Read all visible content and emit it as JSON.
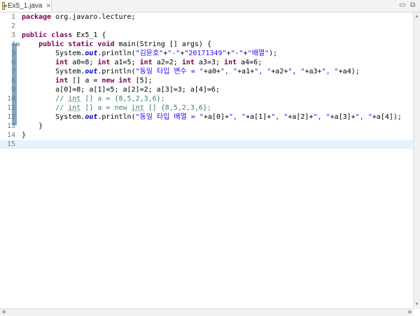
{
  "tab": {
    "label": "Ex5_1.java",
    "close": "✕"
  },
  "window": {
    "minimize": "▭",
    "maximize": "⧉"
  },
  "lines": [
    {
      "n": "1"
    },
    {
      "n": "2"
    },
    {
      "n": "3"
    },
    {
      "n": "4"
    },
    {
      "n": "5"
    },
    {
      "n": "6"
    },
    {
      "n": "7"
    },
    {
      "n": "8"
    },
    {
      "n": "9"
    },
    {
      "n": "10"
    },
    {
      "n": "11"
    },
    {
      "n": "12"
    },
    {
      "n": "13"
    },
    {
      "n": "14"
    },
    {
      "n": "15"
    }
  ],
  "code": {
    "l1": {
      "kw": "package",
      "rest": " org.javaro.lecture;"
    },
    "l3": {
      "kw1": "public",
      "kw2": "class",
      "rest": " Ex5_1 {"
    },
    "l4": {
      "ind": "    ",
      "kw1": "public",
      "kw2": "static",
      "kw3": "void",
      "rest": " main(String [] args) {"
    },
    "l5": {
      "a": "        System.",
      "out": "out",
      "b": ".println(",
      "s1": "\"김윤호\"",
      "c": "+",
      "s2": "\"-\"",
      "d": "+",
      "s3": "\"20171349\"",
      "e": "+",
      "s4": "\"-\"",
      "f": "+",
      "s5": "\"배열\"",
      "g": ");"
    },
    "l6": {
      "i": "        ",
      "kw": "int",
      "a": " a0=8; ",
      "kw2": "int",
      "b": " a1=5; ",
      "kw3": "int",
      "c": " a2=2; ",
      "kw4": "int",
      "d": " a3=3; ",
      "kw5": "int",
      "e": " a4=6;"
    },
    "l7": {
      "a": "        System.",
      "out": "out",
      "b": ".println(",
      "s1": "\"동일 타입 변수 = \"",
      "c": "+a0+",
      "s2": "\", \"",
      "d": "+a1+",
      "s3": "\", \"",
      "e": "+a2+",
      "s4": "\", \"",
      "f": "+a3+",
      "s5": "\", \"",
      "g": "+a4);"
    },
    "l8": {
      "i": "        ",
      "kw": "int",
      "a": " [] a = ",
      "kw2": "new",
      "b": " ",
      "kw3": "int",
      "c": " [5];"
    },
    "l9": {
      "a": "        a[0]=8; a[1]=5; a[2]=2; a[3]=3; a[4]=6;"
    },
    "l10": {
      "i": "        ",
      "a": "// ",
      "u": "int",
      "b": " [] a = {8,5,2,3,6};"
    },
    "l11": {
      "i": "        ",
      "a": "// ",
      "u": "int",
      "b": " [] a = new ",
      "u2": "int",
      "c": " [] {8,5,2,3,6};"
    },
    "l12": {
      "a": "        System.",
      "out": "out",
      "b": ".println(",
      "s1": "\"동일 타입 배열 = \"",
      "c": "+a[0]+",
      "s2": "\", \"",
      "d": "+a[1]+",
      "s3": "\", \"",
      "e": "+a[2]+",
      "s4": "\", \"",
      "f": "+a[3]+",
      "s5": "\", \"",
      "g": "+a[4]);"
    },
    "l13": {
      "a": "    }"
    },
    "l14": {
      "a": "}"
    }
  }
}
